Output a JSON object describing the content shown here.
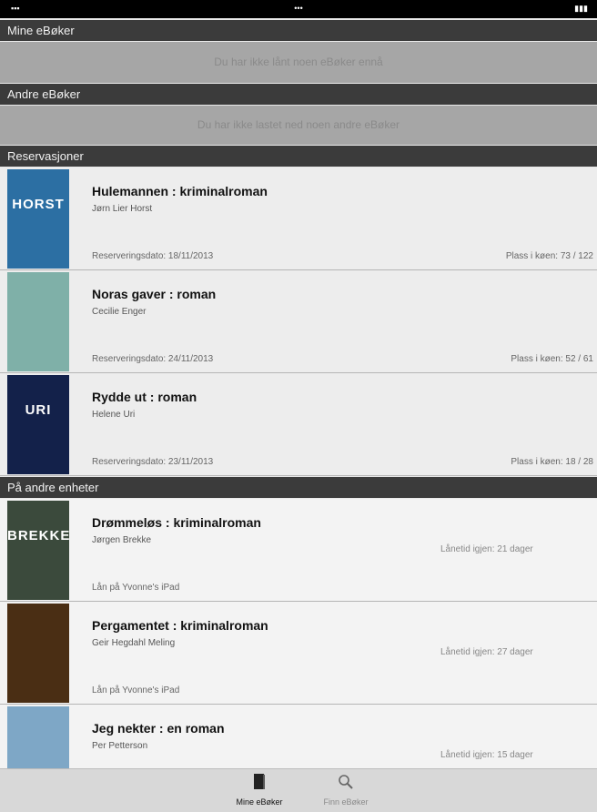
{
  "sections": {
    "my_ebooks": {
      "title": "Mine eBøker",
      "empty_text": "Du har ikke lånt noen eBøker ennå"
    },
    "other_ebooks": {
      "title": "Andre eBøker",
      "empty_text": "Du har ikke lastet ned noen andre eBøker"
    },
    "reservations": {
      "title": "Reservasjoner"
    },
    "other_devices": {
      "title": "På andre enheter"
    }
  },
  "reservations": [
    {
      "title": "Hulemannen : kriminalroman",
      "author": "Jørn Lier Horst",
      "date": "Reserveringsdato: 18/11/2013",
      "queue": "Plass i køen: 73 / 122",
      "cover_text": "HORST",
      "cover_color": "#2c6fa3"
    },
    {
      "title": "Noras gaver : roman",
      "author": "Cecilie Enger",
      "date": "Reserveringsdato: 24/11/2013",
      "queue": "Plass i køen: 52 / 61",
      "cover_text": "",
      "cover_color": "#7fb0a8"
    },
    {
      "title": "Rydde ut : roman",
      "author": "Helene Uri",
      "date": "Reserveringsdato: 23/11/2013",
      "queue": "Plass i køen: 18 / 28",
      "cover_text": "URI",
      "cover_color": "#13214a"
    }
  ],
  "other_devices": [
    {
      "title": "Drømmeløs : kriminalroman",
      "author": "Jørgen Brekke",
      "loan": "Lånetid igjen: 21 dager",
      "device": "Lån på Yvonne's iPad",
      "cover_text": "BREKKE",
      "cover_color": "#3b4a3c"
    },
    {
      "title": "Pergamentet : kriminalroman",
      "author": "Geir Hegdahl Meling",
      "loan": "Lånetid igjen: 27 dager",
      "device": "Lån på Yvonne's iPad",
      "cover_text": "",
      "cover_color": "#4a2e14"
    },
    {
      "title": "Jeg nekter : en roman",
      "author": "Per Petterson",
      "loan": "Lånetid igjen: 15 dager",
      "device": "",
      "cover_text": "",
      "cover_color": "#7ea7c6"
    }
  ],
  "tab_bar": {
    "my_books_label": "Mine eBøker",
    "find_books_label": "Finn eBøker"
  },
  "icons": {
    "my_books": "book-icon",
    "find_books": "search-icon"
  }
}
